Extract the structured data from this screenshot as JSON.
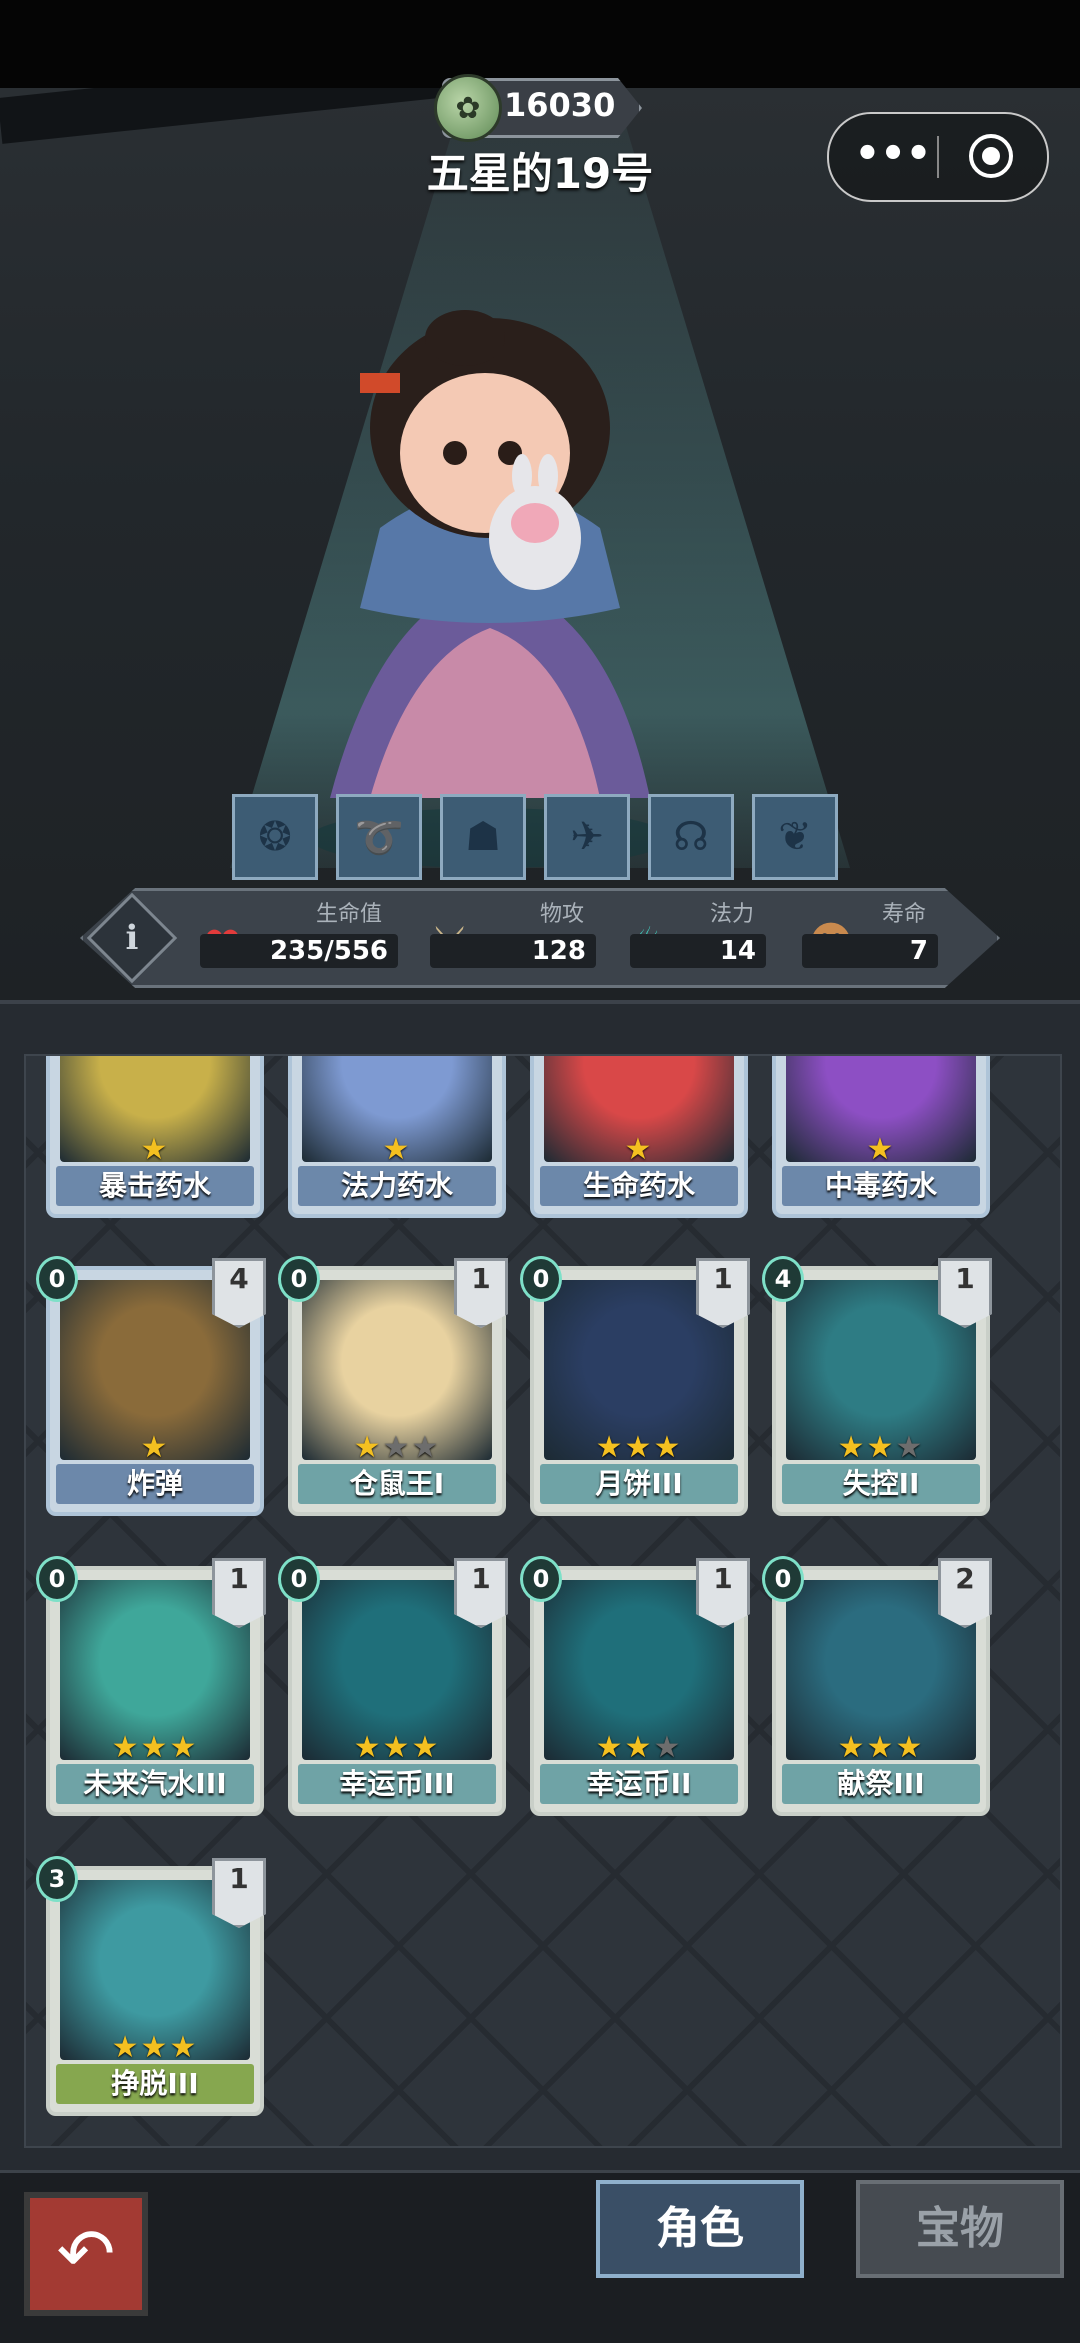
{
  "header": {
    "currency_value": "16030",
    "character_name": "五星的19号",
    "capsule_more": "•••"
  },
  "skills": [
    {
      "icon": "skill-orb-icon"
    },
    {
      "icon": "skill-curl-icon"
    },
    {
      "icon": "skill-ghost-icon"
    },
    {
      "icon": "skill-runner-icon"
    },
    {
      "icon": "skill-hold-icon"
    },
    {
      "icon": "skill-swoosh-icon"
    }
  ],
  "stats": {
    "info_label": "i",
    "hp": {
      "label": "生命值",
      "value": "235/556"
    },
    "attack": {
      "label": "物攻",
      "value": "128"
    },
    "mana": {
      "label": "法力",
      "value": "14"
    },
    "lifespan": {
      "label": "寿命",
      "value": "7"
    }
  },
  "cards": [
    {
      "name": "暴击药水",
      "stars": 1,
      "max_stars": 1,
      "style": "blue",
      "color": "#c8b04a"
    },
    {
      "name": "法力药水",
      "stars": 1,
      "max_stars": 1,
      "style": "blue",
      "color": "#7e9ad2"
    },
    {
      "name": "生命药水",
      "stars": 1,
      "max_stars": 1,
      "style": "blue",
      "color": "#d94848"
    },
    {
      "name": "中毒药水",
      "stars": 1,
      "max_stars": 1,
      "style": "blue",
      "color": "#8d4fc4"
    },
    {
      "name": "炸弹",
      "stars": 1,
      "max_stars": 1,
      "style": "blue",
      "cost": "0",
      "count": "4",
      "color": "#8a6b3a"
    },
    {
      "name": "仓鼠王I",
      "stars": 1,
      "max_stars": 3,
      "style": "green",
      "cost": "0",
      "count": "1",
      "color": "#e8d2a0"
    },
    {
      "name": "月饼III",
      "stars": 3,
      "max_stars": 3,
      "style": "green",
      "cost": "0",
      "count": "1",
      "color": "#2b3e63"
    },
    {
      "name": "失控II",
      "stars": 2,
      "max_stars": 3,
      "style": "green",
      "cost": "4",
      "count": "1",
      "color": "#2e7c84"
    },
    {
      "name": "未来汽水III",
      "stars": 3,
      "max_stars": 3,
      "style": "green",
      "cost": "0",
      "count": "1",
      "color": "#3fa79a"
    },
    {
      "name": "幸运币III",
      "stars": 3,
      "max_stars": 3,
      "style": "green",
      "cost": "0",
      "count": "1",
      "color": "#1f6f7a"
    },
    {
      "name": "幸运币II",
      "stars": 2,
      "max_stars": 3,
      "style": "green",
      "cost": "0",
      "count": "1",
      "color": "#1f6f7a"
    },
    {
      "name": "献祭III",
      "stars": 3,
      "max_stars": 3,
      "style": "green",
      "cost": "0",
      "count": "2",
      "color": "#2b6c7f"
    },
    {
      "name": "挣脱III",
      "stars": 3,
      "max_stars": 3,
      "style": "lime",
      "cost": "3",
      "count": "1",
      "color": "#3e9aa1"
    }
  ],
  "tabs": {
    "role": "角色",
    "treasure": "宝物"
  }
}
